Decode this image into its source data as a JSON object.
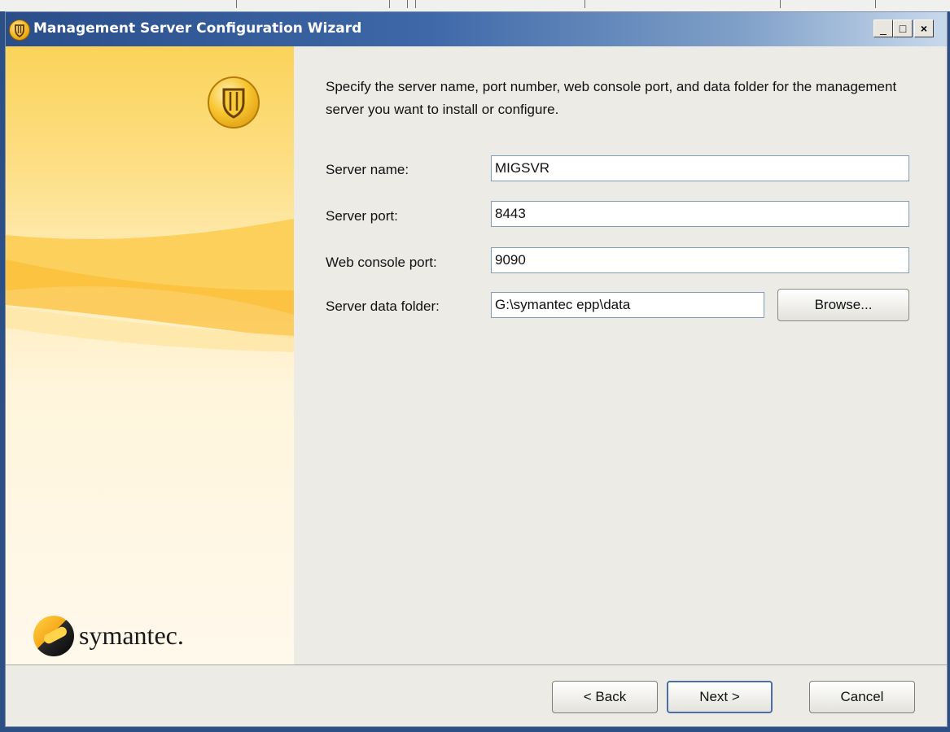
{
  "window": {
    "title": "Management Server Configuration Wizard",
    "min_glyph": "_",
    "max_glyph": "□",
    "close_glyph": "×"
  },
  "panel": {
    "brand": "symantec."
  },
  "instructions": "Specify the server name, port number, web console port, and data folder for the management server you want to install or configure.",
  "fields": {
    "server_name": {
      "label": "Server name:",
      "value": "MIGSVR"
    },
    "server_port": {
      "label": "Server port:",
      "value": "8443"
    },
    "web_console_port": {
      "label": "Web console port:",
      "value": "9090"
    },
    "data_folder": {
      "label": "Server data folder:",
      "value": "G:\\symantec epp\\data"
    }
  },
  "buttons": {
    "browse": "Browse...",
    "back": "< Back",
    "next": "Next >",
    "cancel": "Cancel"
  },
  "colors": {
    "titlebar": "#2a4e8a",
    "accent_gold": "#f2b01c",
    "panel_yellow": "#fbd35a"
  },
  "icons": {
    "title_icon": "symantec-shield-icon",
    "panel_icon": "symantec-shield-icon",
    "brand_icon": "symantec-globe-icon"
  }
}
